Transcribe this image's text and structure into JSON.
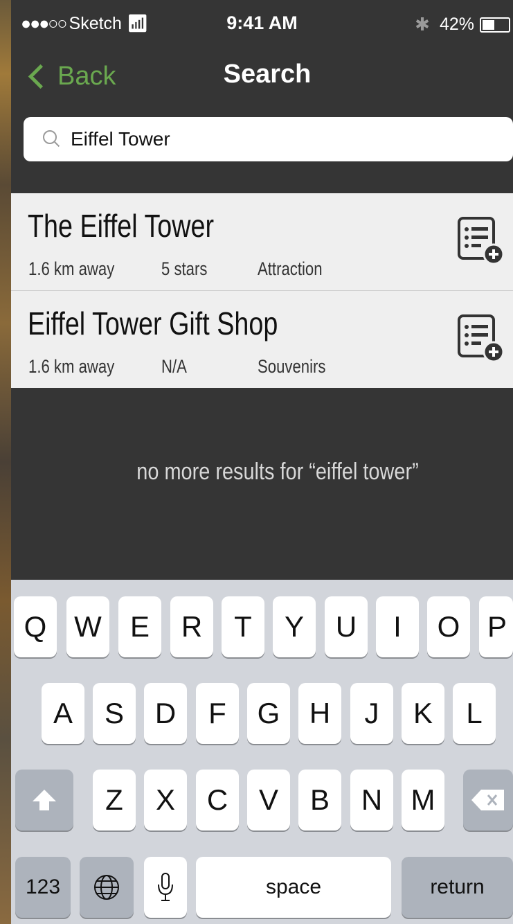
{
  "status_bar": {
    "carrier": "Sketch",
    "time": "9:41 AM",
    "battery": "42%"
  },
  "nav": {
    "back_label": "Back",
    "title": "Search"
  },
  "search": {
    "value": "Eiffel Tower",
    "placeholder": ""
  },
  "results": [
    {
      "name": "The Eiffel Tower",
      "distance": "1.6 km away",
      "rating": "5 stars",
      "category": "Attraction"
    },
    {
      "name": "Eiffel Tower Gift Shop",
      "distance": "1.6 km away",
      "rating": "N/A",
      "category": "Souvenirs"
    }
  ],
  "no_more_text": "no more results for “eiffel tower”",
  "keyboard": {
    "row1": [
      "Q",
      "W",
      "E",
      "R",
      "T",
      "Y",
      "U",
      "I",
      "O",
      "P"
    ],
    "row2": [
      "A",
      "S",
      "D",
      "F",
      "G",
      "H",
      "J",
      "K",
      "L"
    ],
    "row3": [
      "Z",
      "X",
      "C",
      "V",
      "B",
      "N",
      "M"
    ],
    "numbers_label": "123",
    "space_label": "space",
    "return_label": "return"
  },
  "colors": {
    "accent": "#6aa84f",
    "background": "#353535",
    "result_bg": "#efefef"
  }
}
